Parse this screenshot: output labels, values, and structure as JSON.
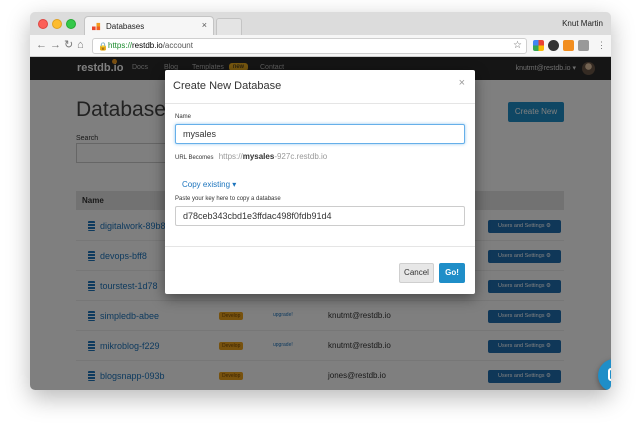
{
  "browser": {
    "tab_title": "Databases",
    "profile_name": "Knut Martin",
    "url_scheme": "https://",
    "url_host": "restdb.io",
    "url_path": "/account"
  },
  "site_nav": {
    "logo": "restdb.io",
    "links": [
      "Docs",
      "Blog",
      "Templates",
      "Contact"
    ],
    "templates_badge": "new",
    "user_menu": "knutmt@restdb.io ▾"
  },
  "page": {
    "title": "Databases",
    "search_label": "Search",
    "create_button": "Create New",
    "table_header_name": "Name",
    "rows": [
      {
        "name": "digitalwork-89b8",
        "plan": "",
        "upgrade": "",
        "owner": "",
        "action": "Users and Settings ⚙"
      },
      {
        "name": "devops-bff8",
        "plan": "",
        "upgrade": "",
        "owner": "",
        "action": "Users and Settings ⚙"
      },
      {
        "name": "tourstest-1d78",
        "plan": "",
        "upgrade": "",
        "owner": "",
        "action": "Users and Settings ⚙"
      },
      {
        "name": "simpledb-abee",
        "plan": "Develop",
        "upgrade": "upgrade!",
        "owner": "knutmt@restdb.io",
        "action": "Users and Settings ⚙"
      },
      {
        "name": "mikroblog-f229",
        "plan": "Develop",
        "upgrade": "upgrade!",
        "owner": "knutmt@restdb.io",
        "action": "Users and Settings ⚙"
      },
      {
        "name": "blogsnapp-093b",
        "plan": "Develop",
        "upgrade": "",
        "owner": "jones@restdb.io",
        "action": "Users and Settings ⚙"
      }
    ]
  },
  "modal": {
    "title": "Create New Database",
    "close_glyph": "×",
    "name_label": "Name",
    "name_value": "mysales",
    "url_prefix": "URL Becomes",
    "url_scheme": "https://",
    "url_name": "mysales",
    "url_suffix": "-927c.restdb.io",
    "copy_existing": "Copy existing ▾",
    "key_label": "Paste your key here to copy a database",
    "key_value": "d78ceb343cbd1e3ffdac498f0fdb91d4",
    "cancel_label": "Cancel",
    "go_label": "Go!"
  }
}
